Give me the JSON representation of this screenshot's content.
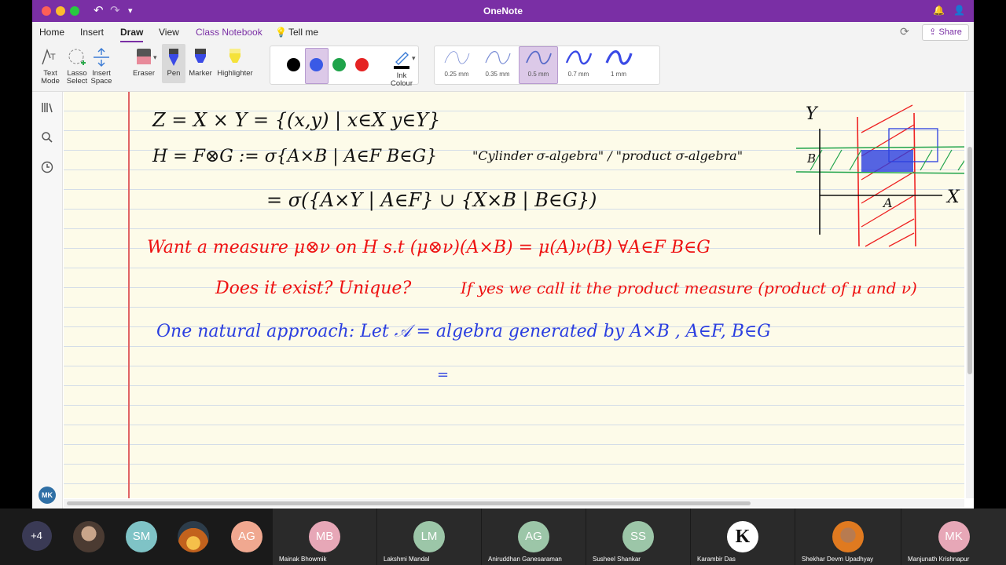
{
  "app": {
    "title": "OneNote"
  },
  "menu": {
    "tabs": [
      "Home",
      "Insert",
      "Draw",
      "View",
      "Class Notebook"
    ],
    "active": "Draw",
    "tell_me": "Tell me",
    "share": "Share"
  },
  "ribbon": {
    "tools": [
      "Text Mode",
      "Lasso Select",
      "Insert Space"
    ],
    "pens": [
      "Eraser",
      "Pen",
      "Marker",
      "Highlighter"
    ],
    "ink_colour_label": "Ink Colour",
    "colors": [
      "#000000",
      "#3a5ae6",
      "#1fa34a",
      "#e52323"
    ],
    "selected_color": "#3a5ae6",
    "thickness": [
      "0.25 mm",
      "0.35 mm",
      "0.5 mm",
      "0.7 mm",
      "1 mm"
    ],
    "selected_thickness": "0.5 mm"
  },
  "note": {
    "line1": "Z = X × Y = {(x,y) | x∈X  y∈Y}",
    "line2a": "H = F⊗G := σ{A×B | A∈F  B∈G}",
    "line2b": "\"Cylinder σ-algebra\" / \"product σ-algebra\"",
    "line3": "= σ({A×Y | A∈F} ∪ {X×B | B∈G})",
    "line4": "Want a measure μ⊗ν on H  s.t  (μ⊗ν)(A×B) = μ(A)ν(B)  ∀A∈F B∈G",
    "line5a": "Does it exist?   Unique?",
    "line5b": "If yes we call it the   product measure (product of μ and ν)",
    "line6": "One natural approach:  Let 𝒜 = algebra generated by A×B ,  A∈F, B∈G",
    "line7": "=",
    "diagram": {
      "y_label": "Y",
      "x_label": "X",
      "a_label": "A",
      "b_label": "B"
    }
  },
  "user_badge": "MK",
  "participants": [
    {
      "initials": "+4",
      "name": "",
      "color": "#3a3a55"
    },
    {
      "initials": "",
      "name": "",
      "color": "#6b5a4a"
    },
    {
      "initials": "SM",
      "name": "",
      "color": "#7fc3c6"
    },
    {
      "initials": "",
      "name": "",
      "color": "#b5651d"
    },
    {
      "initials": "AG",
      "name": "",
      "color": "#f0a890"
    },
    {
      "initials": "MB",
      "name": "Mainak Bhowmik",
      "color": "#e7a7b7"
    },
    {
      "initials": "LM",
      "name": "Lakshmi Mandal",
      "color": "#9cc6a8"
    },
    {
      "initials": "AG",
      "name": "Aniruddhan Ganesaraman",
      "color": "#9cc6a8"
    },
    {
      "initials": "SS",
      "name": "Susheel Shankar",
      "color": "#9cc6a8"
    },
    {
      "initials": "K",
      "name": "Karambir Das",
      "color": "#111111"
    },
    {
      "initials": "",
      "name": "Shekhar Devm Upadhyay",
      "color": "#b5651d"
    },
    {
      "initials": "MK",
      "name": "Manjunath Krishnapur",
      "color": "#e7a7b7"
    }
  ]
}
